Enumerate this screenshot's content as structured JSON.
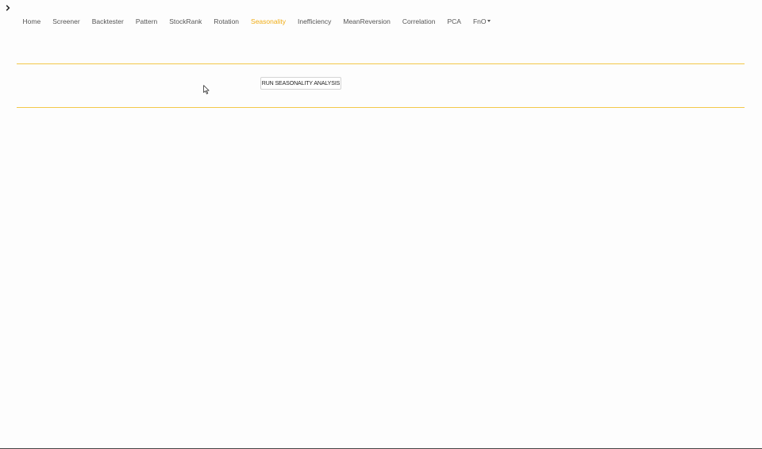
{
  "sidebar": {
    "toggle_icon": "chevron-right-icon"
  },
  "nav": {
    "items": [
      {
        "label": "Home"
      },
      {
        "label": "Screener"
      },
      {
        "label": "Backtester"
      },
      {
        "label": "Pattern"
      },
      {
        "label": "StockRank"
      },
      {
        "label": "Rotation"
      },
      {
        "label": "Seasonality",
        "active": true
      },
      {
        "label": "Inefficiency"
      },
      {
        "label": "MeanReversion"
      },
      {
        "label": "Correlation"
      },
      {
        "label": "PCA"
      },
      {
        "label": "FnO",
        "dropdown": true
      }
    ],
    "active_color": "#f0ad16"
  },
  "main": {
    "run_button_label": "RUN SEASONALITY ANALYSIS",
    "rule_color": "#f3c84a"
  }
}
